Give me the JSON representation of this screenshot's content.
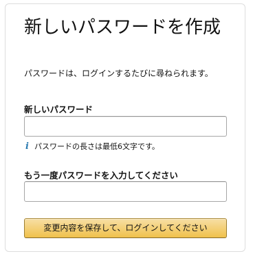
{
  "form": {
    "title": "新しいパスワードを作成",
    "instructions": "パスワードは、ログインするたびに尋ねられます。",
    "new_password": {
      "label": "新しいパスワード",
      "value": "",
      "placeholder": ""
    },
    "hint": {
      "icon": "info-icon",
      "icon_glyph": "i",
      "text": "パスワードの長さは最低6文字です。"
    },
    "confirm_password": {
      "label": "もう一度パスワードを入力してください",
      "value": "",
      "placeholder": ""
    },
    "submit_label": "変更内容を保存して、ログインしてください",
    "colors": {
      "button_top": "#f7dfa5",
      "button_bottom": "#f0c14b",
      "button_border": "#a88734",
      "info_icon": "#2a7ab0",
      "card_border": "#dddddd"
    }
  }
}
